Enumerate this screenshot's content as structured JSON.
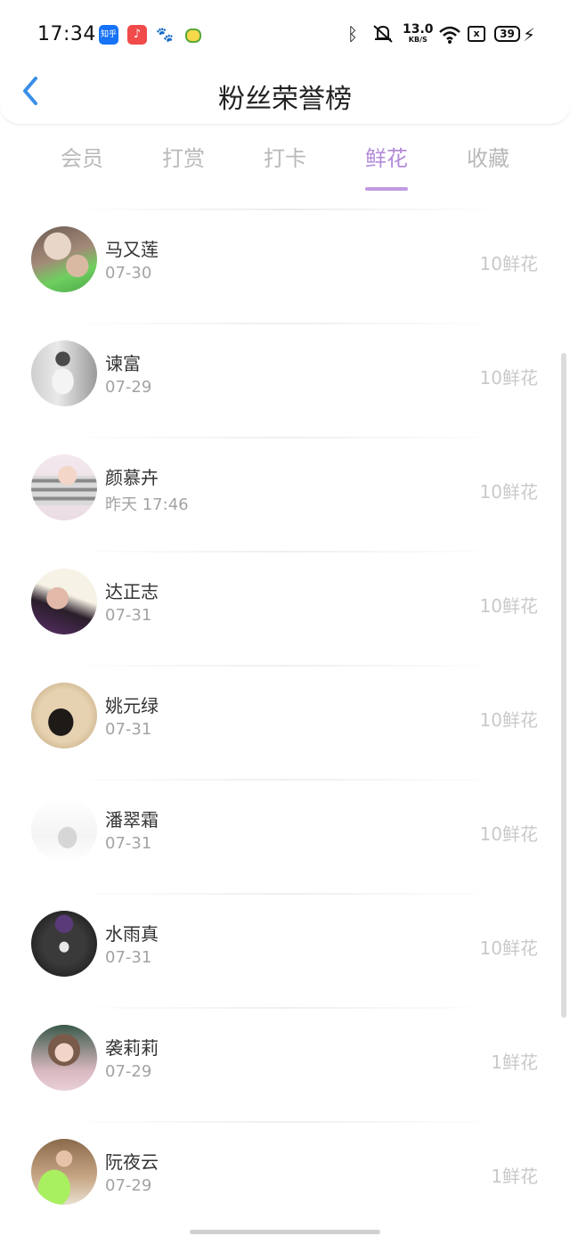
{
  "status_bar": {
    "time": "17:34",
    "apps": [
      "zhihu-icon",
      "music-icon",
      "paw-icon",
      "mascot-icon"
    ],
    "zhihu_label": "知乎",
    "net_speed": "13.0",
    "net_unit": "KB/S",
    "sim": "x",
    "battery": "39"
  },
  "nav": {
    "title": "粉丝荣誉榜",
    "back_icon": "chevron-left-icon"
  },
  "tabs": [
    {
      "label": "会员",
      "active": false
    },
    {
      "label": "打赏",
      "active": false
    },
    {
      "label": "打卡",
      "active": false
    },
    {
      "label": "鲜花",
      "active": true
    },
    {
      "label": "收藏",
      "active": false
    }
  ],
  "colors": {
    "accent": "#b38bd9",
    "back_arrow": "#3a8ee6",
    "amount": "#c9c9c9"
  },
  "fans": [
    {
      "name": "马又莲",
      "date": "07-30",
      "amount": "10鲜花"
    },
    {
      "name": "谏富",
      "date": "07-29",
      "amount": "10鲜花"
    },
    {
      "name": "颜慕卉",
      "date": "昨天 17:46",
      "amount": "10鲜花"
    },
    {
      "name": "达正志",
      "date": "07-31",
      "amount": "10鲜花"
    },
    {
      "name": "姚元绿",
      "date": "07-31",
      "amount": "10鲜花"
    },
    {
      "name": "潘翠霜",
      "date": "07-31",
      "amount": "10鲜花"
    },
    {
      "name": "水雨真",
      "date": "07-31",
      "amount": "10鲜花"
    },
    {
      "name": "袭莉莉",
      "date": "07-29",
      "amount": "1鲜花"
    },
    {
      "name": "阮夜云",
      "date": "07-29",
      "amount": "1鲜花"
    }
  ]
}
